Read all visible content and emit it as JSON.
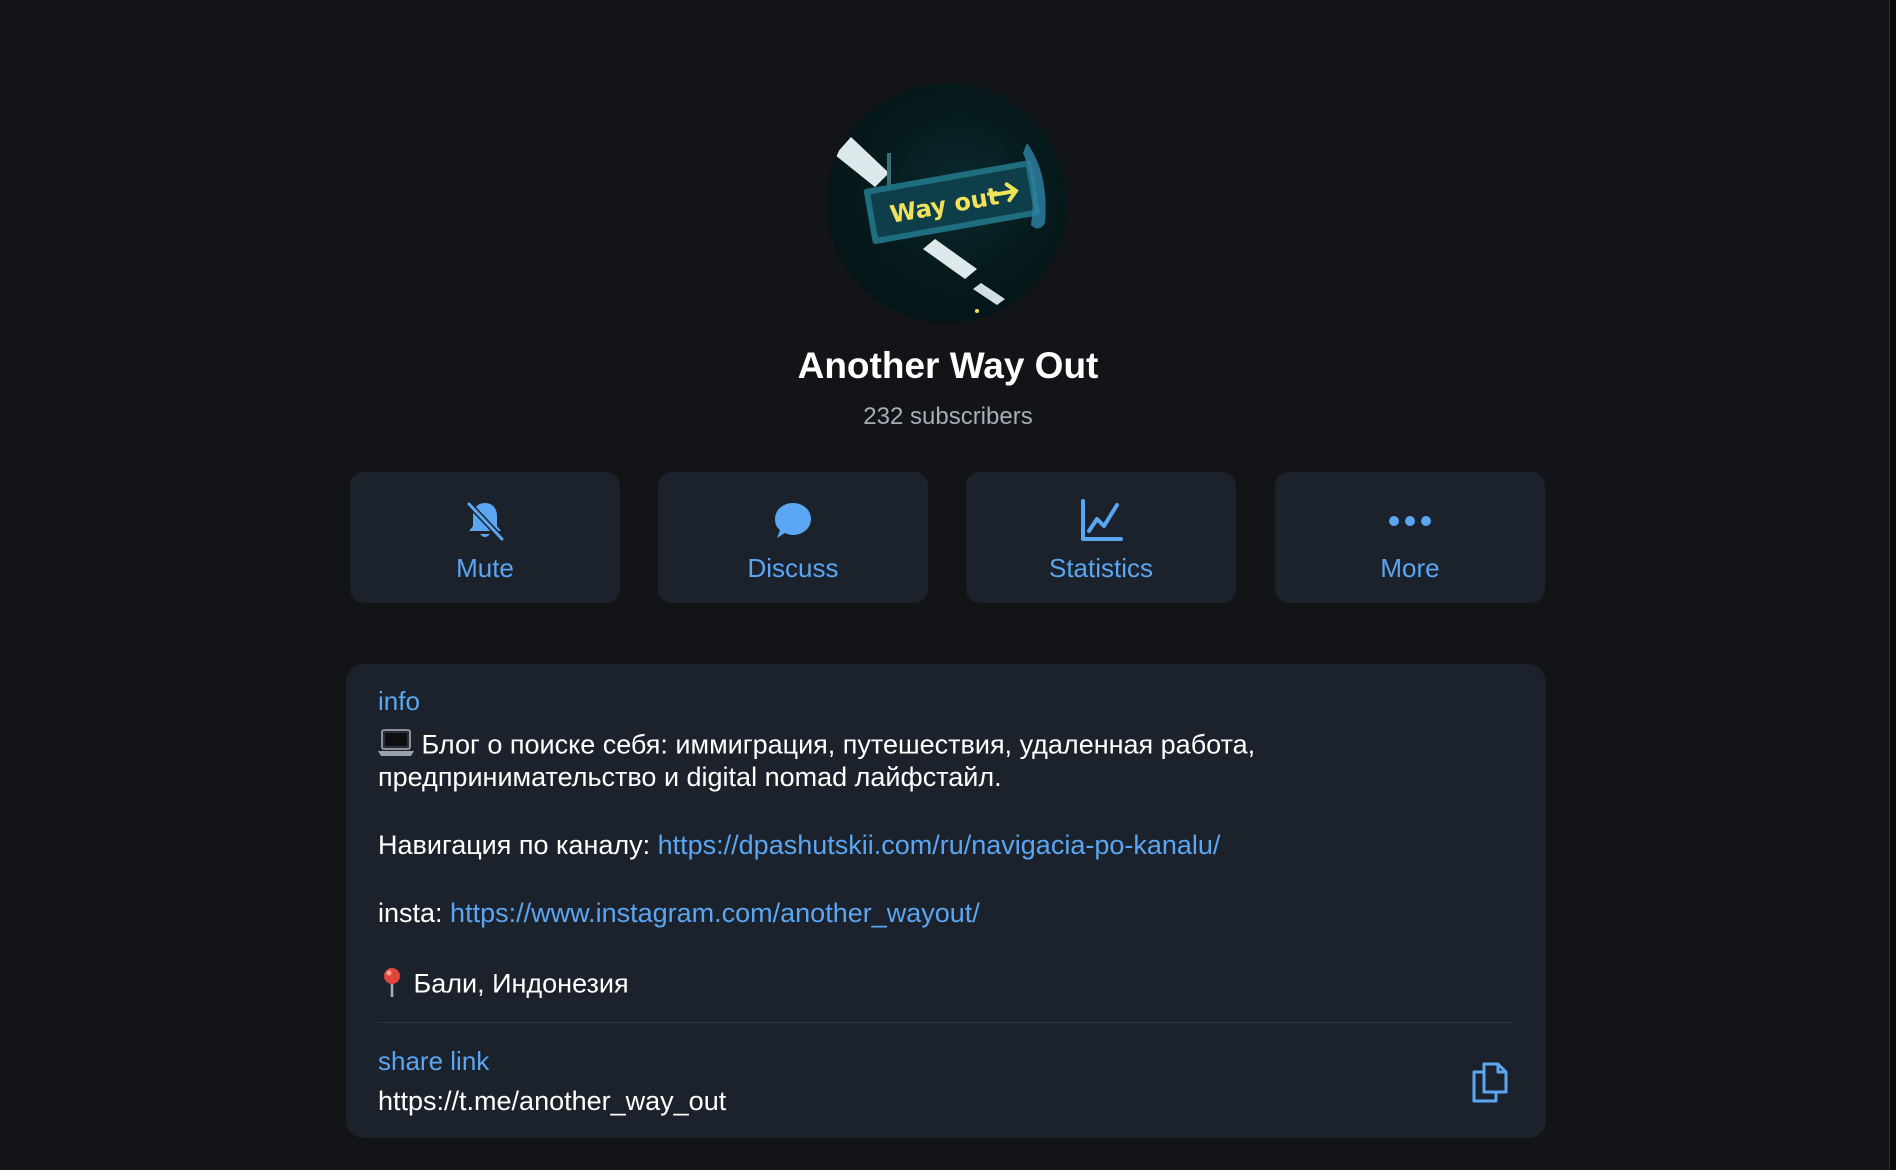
{
  "channel": {
    "name": "Another Way Out",
    "subscribers": "232 subscribers",
    "avatar_sign_text": "Way out",
    "avatar_icon": "way-out-sign-image"
  },
  "actions": [
    {
      "label": "Mute",
      "icon": "bell-slash-icon"
    },
    {
      "label": "Discuss",
      "icon": "chat-bubble-icon"
    },
    {
      "label": "Statistics",
      "icon": "chart-icon"
    },
    {
      "label": "More",
      "icon": "ellipsis-icon"
    }
  ],
  "info": {
    "label": "info",
    "line1": "Блог о поиске себя: иммиграция, путешествия, удаленная работа,",
    "line2": "предпринимательство и digital nomad лайфстайл.",
    "nav_prefix": "Навигация по каналу: ",
    "nav_link": "https://dpashutskii.com/ru/navigacia-po-kanalu/",
    "insta_prefix": "insta: ",
    "insta_link": "https://www.instagram.com/another_wayout/",
    "location": "Бали, Индонезия"
  },
  "share": {
    "label": "share link",
    "url": "https://t.me/another_way_out",
    "copy_icon": "copy-icon"
  },
  "colors": {
    "background": "#131417",
    "card": "#1c222c",
    "accent": "#5aa6f2",
    "muted_text": "#a7adb5"
  }
}
